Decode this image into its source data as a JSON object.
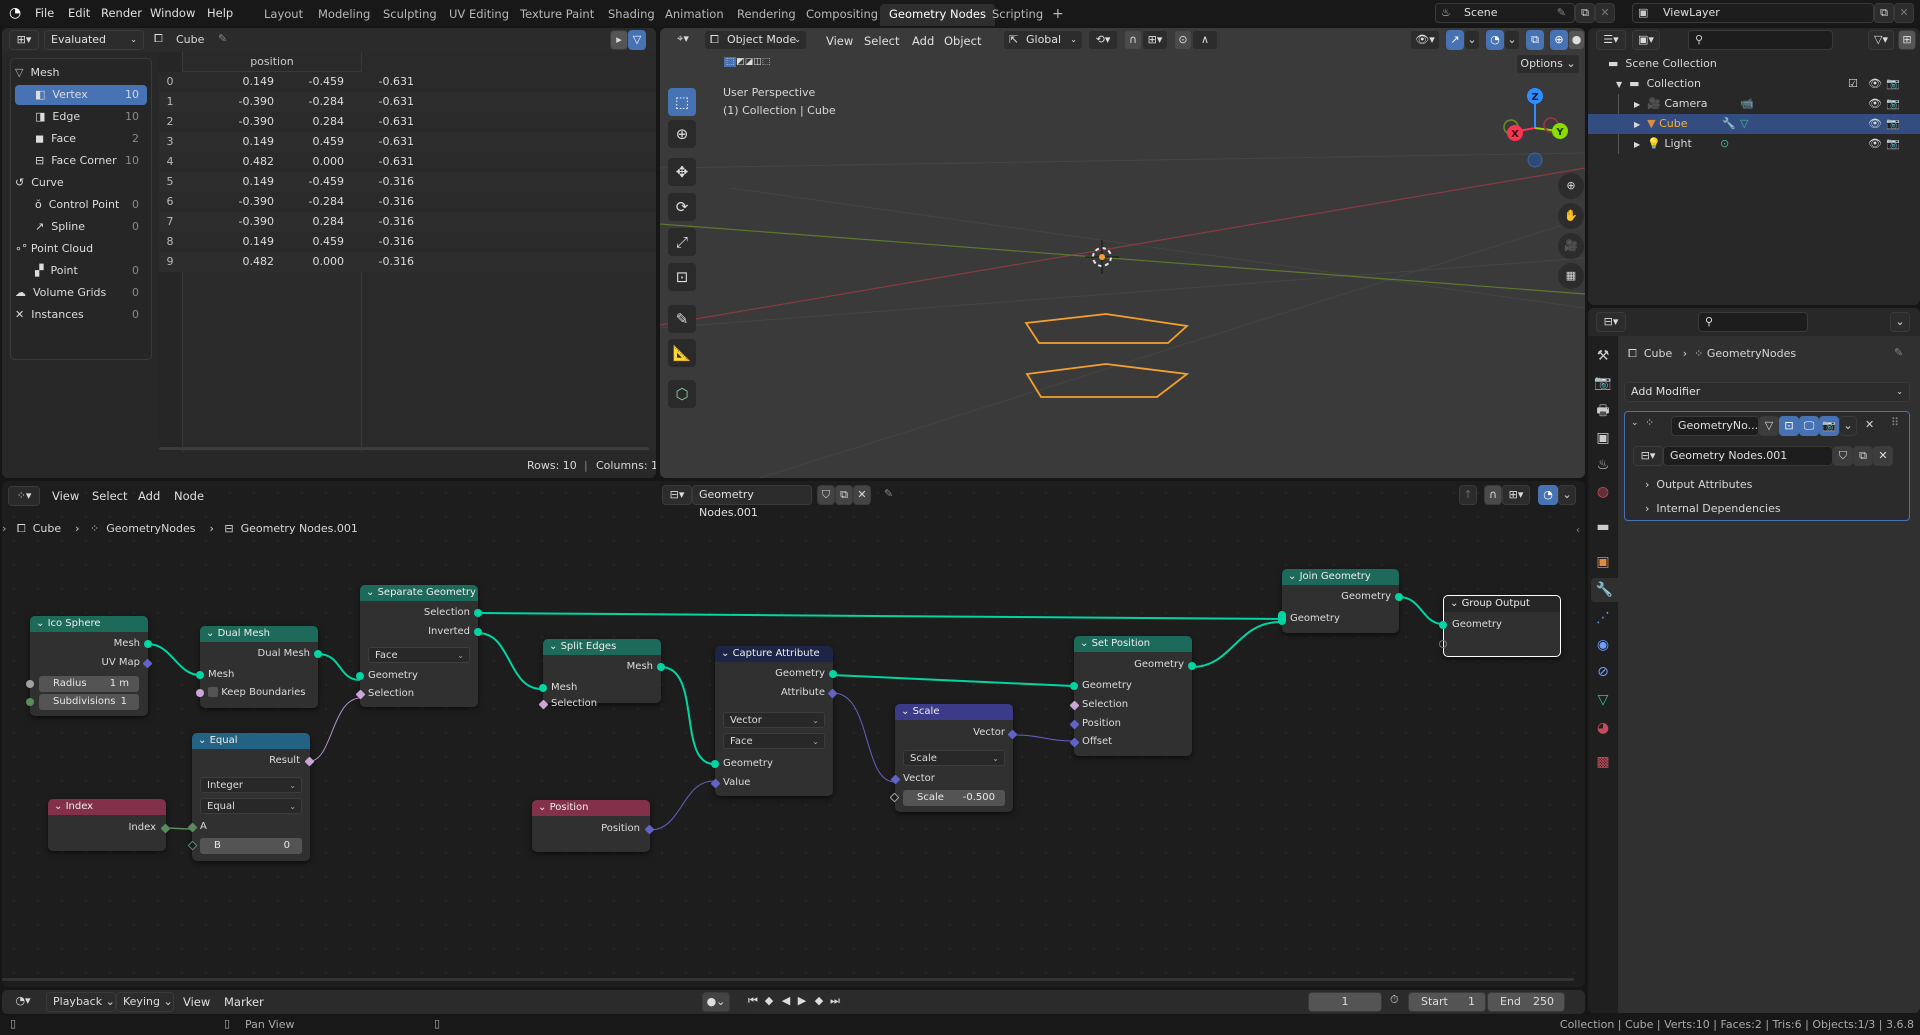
{
  "topbar": {
    "menus": [
      "File",
      "Edit",
      "Render",
      "Window",
      "Help"
    ],
    "workspaces": [
      "Layout",
      "Modeling",
      "Sculpting",
      "UV Editing",
      "Texture Paint",
      "Shading",
      "Animation",
      "Rendering",
      "Compositing",
      "Geometry Nodes",
      "Scripting"
    ],
    "active_workspace": "Geometry Nodes",
    "add_tab": "+",
    "scene": "Scene",
    "view_layer": "ViewLayer"
  },
  "spreadsheet": {
    "mode": "Evaluated",
    "object": "Cube",
    "tree": [
      {
        "label": "Mesh",
        "count": "",
        "level": 0,
        "icon": "mesh-icon"
      },
      {
        "label": "Vertex",
        "count": "10",
        "level": 1,
        "icon": "vertex-icon",
        "active": true
      },
      {
        "label": "Edge",
        "count": "10",
        "level": 1,
        "icon": "edge-icon"
      },
      {
        "label": "Face",
        "count": "2",
        "level": 1,
        "icon": "face-icon"
      },
      {
        "label": "Face Corner",
        "count": "10",
        "level": 1,
        "icon": "face-corner-icon"
      },
      {
        "label": "Curve",
        "count": "",
        "level": 0,
        "icon": "curve-icon"
      },
      {
        "label": "Control Point",
        "count": "0",
        "level": 1,
        "icon": "control-point-icon"
      },
      {
        "label": "Spline",
        "count": "0",
        "level": 1,
        "icon": "spline-icon"
      },
      {
        "label": "Point Cloud",
        "count": "",
        "level": 0,
        "icon": "point-cloud-icon"
      },
      {
        "label": "Point",
        "count": "0",
        "level": 1,
        "icon": "point-icon"
      },
      {
        "label": "Volume Grids",
        "count": "0",
        "level": 0,
        "icon": "volume-icon"
      },
      {
        "label": "Instances",
        "count": "0",
        "level": 0,
        "icon": "instances-icon"
      }
    ],
    "column_header": "position",
    "rows": [
      [
        "0",
        "0.149",
        "-0.459",
        "-0.631"
      ],
      [
        "1",
        "-0.390",
        "-0.284",
        "-0.631"
      ],
      [
        "2",
        "-0.390",
        "0.284",
        "-0.631"
      ],
      [
        "3",
        "0.149",
        "0.459",
        "-0.631"
      ],
      [
        "4",
        "0.482",
        "0.000",
        "-0.631"
      ],
      [
        "5",
        "0.149",
        "-0.459",
        "-0.316"
      ],
      [
        "6",
        "-0.390",
        "-0.284",
        "-0.316"
      ],
      [
        "7",
        "-0.390",
        "0.284",
        "-0.316"
      ],
      [
        "8",
        "0.149",
        "0.459",
        "-0.316"
      ],
      [
        "9",
        "0.482",
        "0.000",
        "-0.316"
      ]
    ],
    "footer_rows": "Rows: 10",
    "footer_sep": "|",
    "footer_cols": "Columns: 1"
  },
  "viewport": {
    "mode": "Object Mode",
    "menus": [
      "View",
      "Select",
      "Add",
      "Object"
    ],
    "orientation": "Global",
    "options": "Options",
    "overlay_line1": "User Perspective",
    "overlay_line2": "(1) Collection | Cube",
    "gizmo": {
      "x": "X",
      "y": "Y",
      "z": "Z"
    }
  },
  "outliner": {
    "root": "Scene Collection",
    "collection": "Collection",
    "items": [
      {
        "label": "Camera",
        "icon": "camera-icon"
      },
      {
        "label": "Cube",
        "icon": "mesh-object-icon",
        "selected": true
      },
      {
        "label": "Light",
        "icon": "light-icon"
      }
    ]
  },
  "properties": {
    "breadcrumb_object": "Cube",
    "breadcrumb_modifier": "GeometryNodes",
    "add_modifier": "Add Modifier",
    "modifier_name": "GeometryNo...",
    "node_group": "Geometry Nodes.001",
    "panels": [
      "Output Attributes",
      "Internal Dependencies"
    ]
  },
  "node_editor": {
    "menus": [
      "View",
      "Select",
      "Add",
      "Node"
    ],
    "node_group": "Geometry Nodes.001",
    "breadcrumb": [
      "Cube",
      "GeometryNodes",
      "Geometry Nodes.001"
    ],
    "nodes": {
      "ico_sphere": {
        "title": "Ico Sphere",
        "out_mesh": "Mesh",
        "out_uv": "UV Map",
        "radius_label": "Radius",
        "radius_value": "1 m",
        "subdiv_label": "Subdivisions",
        "subdiv_value": "1"
      },
      "dual_mesh": {
        "title": "Dual Mesh",
        "out": "Dual Mesh",
        "in_mesh": "Mesh",
        "keep_boundaries": "Keep Boundaries"
      },
      "separate_geometry": {
        "title": "Separate Geometry",
        "out_selection": "Selection",
        "out_inverted": "Inverted",
        "domain": "Face",
        "in_geometry": "Geometry",
        "in_selection": "Selection"
      },
      "split_edges": {
        "title": "Split Edges",
        "out": "Mesh",
        "in_mesh": "Mesh",
        "in_selection": "Selection"
      },
      "capture_attribute": {
        "title": "Capture Attribute",
        "out_geometry": "Geometry",
        "out_attribute": "Attribute",
        "type": "Vector",
        "domain": "Face",
        "in_geometry": "Geometry",
        "in_value": "Value"
      },
      "scale": {
        "title": "Scale",
        "out": "Vector",
        "operation": "Scale",
        "in_vector": "Vector",
        "scale_label": "Scale",
        "scale_value": "-0.500"
      },
      "set_position": {
        "title": "Set Position",
        "out": "Geometry",
        "in_geometry": "Geometry",
        "in_selection": "Selection",
        "in_position": "Position",
        "in_offset": "Offset"
      },
      "join_geometry": {
        "title": "Join Geometry",
        "out": "Geometry",
        "in": "Geometry"
      },
      "group_output": {
        "title": "Group Output",
        "in": "Geometry"
      },
      "equal": {
        "title": "Equal",
        "out": "Result",
        "type": "Integer",
        "mode": "Equal",
        "in_a": "A",
        "b_label": "B",
        "b_value": "0"
      },
      "index": {
        "title": "Index",
        "out": "Index"
      },
      "position": {
        "title": "Position",
        "out": "Position"
      }
    }
  },
  "timeline": {
    "menus": [
      "Playback",
      "Keying",
      "View",
      "Marker"
    ],
    "current_frame": "1",
    "start_label": "Start",
    "start": "1",
    "end_label": "End",
    "end": "250"
  },
  "statusbar": {
    "hint": "Pan View",
    "stats": "Collection | Cube | Verts:10 | Faces:2 | Tris:6 | Objects:1/3 | 3.6.8"
  },
  "colors": {
    "accent": "#4772b3",
    "geometry_socket": "#00d6a3",
    "vector_socket": "#6363c7",
    "selection_orange": "#f5a02c",
    "geometry_header": "#1e6a5a",
    "input_header": "#83314a",
    "converter_header": "#246283",
    "vector_header": "#3b3b8a",
    "attribute_header": "#1d2546"
  }
}
